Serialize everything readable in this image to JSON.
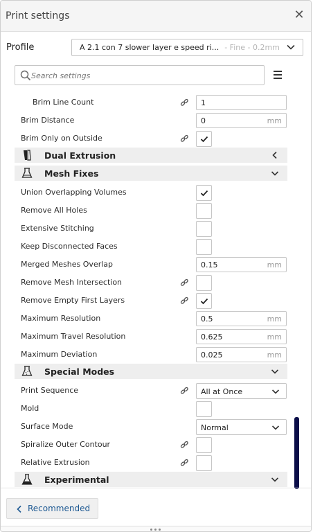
{
  "window": {
    "title": "Print settings"
  },
  "profile": {
    "label": "Profile",
    "name": "A 2.1 con 7 slower layer e speed ri...",
    "quality": "- Fine - 0.2mm"
  },
  "search": {
    "placeholder": "Search settings"
  },
  "rows": [
    {
      "label": "Brim Line Count",
      "value": "1"
    },
    {
      "label": "Brim Distance",
      "value": "0",
      "unit": "mm"
    },
    {
      "label": "Brim Only on Outside",
      "checked": true
    },
    {
      "category": "Dual Extrusion"
    },
    {
      "category": "Mesh Fixes"
    },
    {
      "label": "Union Overlapping Volumes",
      "checked": true
    },
    {
      "label": "Remove All Holes",
      "checked": false
    },
    {
      "label": "Extensive Stitching",
      "checked": false
    },
    {
      "label": "Keep Disconnected Faces",
      "checked": false
    },
    {
      "label": "Merged Meshes Overlap",
      "value": "0.15",
      "unit": "mm"
    },
    {
      "label": "Remove Mesh Intersection",
      "checked": false
    },
    {
      "label": "Remove Empty First Layers",
      "checked": true
    },
    {
      "label": "Maximum Resolution",
      "value": "0.5",
      "unit": "mm"
    },
    {
      "label": "Maximum Travel Resolution",
      "value": "0.625",
      "unit": "mm"
    },
    {
      "label": "Maximum Deviation",
      "value": "0.025",
      "unit": "mm"
    },
    {
      "category": "Special Modes"
    },
    {
      "label": "Print Sequence",
      "selected": "All at Once"
    },
    {
      "label": "Mold",
      "checked": false
    },
    {
      "label": "Surface Mode",
      "selected": "Normal"
    },
    {
      "label": "Spiralize Outer Contour",
      "checked": false
    },
    {
      "label": "Relative Extrusion",
      "checked": false
    },
    {
      "category": "Experimental"
    }
  ],
  "footer": {
    "recommended_label": "Recommended"
  },
  "colors": {
    "scrollbar": "#0b0e49",
    "link_text": "#1f5a93"
  }
}
